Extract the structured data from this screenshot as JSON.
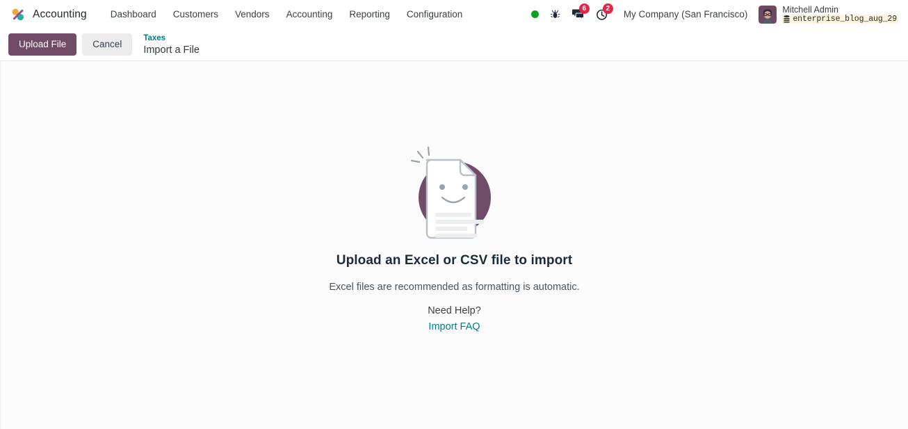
{
  "navbar": {
    "logo_icon": "odoo-percent-logo",
    "app_name": "Accounting",
    "menu_items": [
      {
        "label": "Dashboard",
        "name": "dashboard"
      },
      {
        "label": "Customers",
        "name": "customers"
      },
      {
        "label": "Vendors",
        "name": "vendors"
      },
      {
        "label": "Accounting",
        "name": "accounting"
      },
      {
        "label": "Reporting",
        "name": "reporting"
      },
      {
        "label": "Configuration",
        "name": "configuration"
      }
    ],
    "systray": {
      "status_indicator": {
        "icon": "green-status-dot",
        "color": "#0f9d26"
      },
      "debug": {
        "icon": "bug-icon"
      },
      "messages": {
        "icon": "messages-icon",
        "count": "6"
      },
      "activities": {
        "icon": "clock-activity-icon",
        "count": "2"
      },
      "company": "My Company (San Francisco)",
      "user": {
        "name": "Mitchell Admin",
        "database": "enterprise_blog_aug_29",
        "database_icon": "database-icon",
        "avatar_icon": "user-avatar"
      }
    }
  },
  "control_panel": {
    "upload_label": "Upload File",
    "cancel_label": "Cancel",
    "breadcrumb_parent": "Taxes",
    "breadcrumb_current": "Import a File"
  },
  "main": {
    "illustration_icon": "smiling-document-illustration",
    "title": "Upload an Excel or CSV file to import",
    "subtitle": "Excel files are recommended as formatting is automatic.",
    "help_label": "Need Help?",
    "faq_link": "Import FAQ"
  },
  "colors": {
    "primary_purple": "#714B67",
    "link_teal": "#017E84",
    "badge_red": "#E5234B",
    "status_green": "#0F9D26"
  }
}
